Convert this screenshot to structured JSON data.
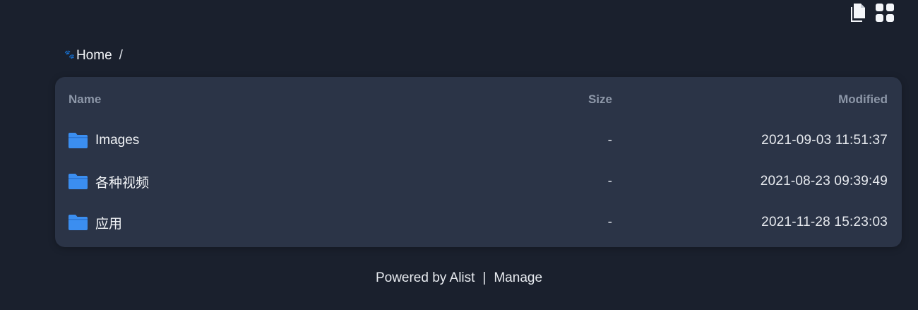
{
  "toolbar": {
    "list_view_icon": "copy-icon",
    "grid_view_icon": "grid-icon"
  },
  "breadcrumb": {
    "icon": "paw-icon",
    "home_label": "Home",
    "separator": "/"
  },
  "table": {
    "columns": {
      "name": "Name",
      "size": "Size",
      "modified": "Modified"
    },
    "rows": [
      {
        "name": "Images",
        "size": "-",
        "modified": "2021-09-03 11:51:37",
        "icon": "folder-icon"
      },
      {
        "name": "各种视频",
        "size": "-",
        "modified": "2021-08-23 09:39:49",
        "icon": "folder-icon"
      },
      {
        "name": "应用",
        "size": "-",
        "modified": "2021-11-28 15:23:03",
        "icon": "folder-icon"
      }
    ]
  },
  "footer": {
    "powered_by": "Powered by Alist",
    "separator": "|",
    "manage": "Manage"
  },
  "colors": {
    "background": "#1a202d",
    "card": "#2b3447",
    "folder": "#3b8ef0",
    "muted_text": "#8d97a8"
  }
}
